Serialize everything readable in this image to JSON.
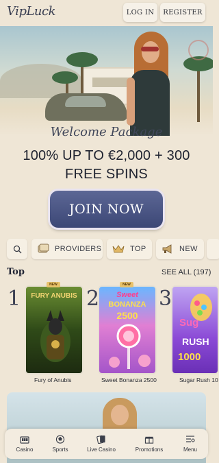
{
  "header": {
    "logo": "VipLuck",
    "login_label": "LOG IN",
    "register_label": "REGISTER"
  },
  "hero": {
    "welcome": "Welcome Package",
    "offer": "100% UP TO €2,000 + 300 FREE SPINS",
    "cta_label": "JOIN NOW"
  },
  "filters": [
    {
      "icon": "search-icon",
      "label": ""
    },
    {
      "icon": "providers-icon",
      "label": "PROVIDERS"
    },
    {
      "icon": "crown-icon",
      "label": "TOP"
    },
    {
      "icon": "megaphone-icon",
      "label": "NEW"
    }
  ],
  "top_section": {
    "title": "Top",
    "see_all": "SEE ALL (197)",
    "games": [
      {
        "rank": "1",
        "name": "Fury of Anubis",
        "badge": "NEW",
        "art": "FURY ANUBIS"
      },
      {
        "rank": "2",
        "name": "Sweet Bonanza 2500",
        "badge": "NEW",
        "art_top": "Sweet",
        "art_mid": "BONANZA",
        "art_bottom": "2500"
      },
      {
        "rank": "3",
        "name": "Sugar Rush 10",
        "art_top": "Sug",
        "art_mid": "RUSH",
        "art_bottom": "1000"
      }
    ]
  },
  "nav": [
    {
      "icon": "casino-icon",
      "label": "Casino"
    },
    {
      "icon": "sports-icon",
      "label": "Sports"
    },
    {
      "icon": "live-casino-icon",
      "label": "Live Casino"
    },
    {
      "icon": "promotions-icon",
      "label": "Promotions"
    },
    {
      "icon": "menu-icon",
      "label": "Menu"
    }
  ],
  "colors": {
    "background": "#efe6d6",
    "cta": "#4a5585",
    "text": "#2c2f36"
  }
}
